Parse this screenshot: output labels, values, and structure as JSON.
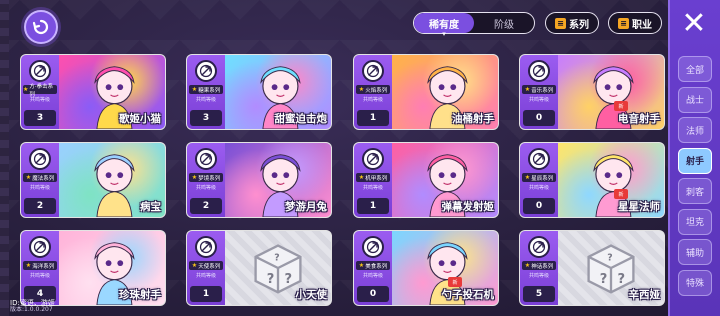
{
  "tabs": [
    {
      "label": "稀有度",
      "active": true
    },
    {
      "label": "阶级",
      "active": false
    }
  ],
  "filters": {
    "series_label": "系列",
    "job_label": "职业"
  },
  "side_tabs": [
    {
      "label": "全部"
    },
    {
      "label": "战士"
    },
    {
      "label": "法师"
    },
    {
      "label": "射手",
      "active": true
    },
    {
      "label": "刺客"
    },
    {
      "label": "坦克"
    },
    {
      "label": "辅助"
    },
    {
      "label": "特殊"
    }
  ],
  "cards": [
    {
      "name": "歌姬小猫",
      "count": "3",
      "tag": "方·拳击系列",
      "sub": "共鸣等级",
      "locked": false,
      "colors": [
        "#ff4fae",
        "#ffd94a",
        "#8b5cf6"
      ]
    },
    {
      "name": "甜蜜迫击炮",
      "count": "3",
      "tag": "糖果系列",
      "sub": "共鸣等级",
      "locked": false,
      "colors": [
        "#6fe0ff",
        "#ff86c8",
        "#b18cff"
      ]
    },
    {
      "name": "油桶射手",
      "count": "1",
      "tag": "火焰系列",
      "sub": "共鸣等级",
      "locked": false,
      "colors": [
        "#ffb347",
        "#ffe08a",
        "#ff7eb3"
      ]
    },
    {
      "name": "电音射手",
      "count": "0",
      "tag": "音乐系列",
      "sub": "共鸣等级",
      "locked": false,
      "colors": [
        "#c77dff",
        "#ff5fa2",
        "#ffd166"
      ],
      "badge": "新"
    },
    {
      "name": "病宝",
      "count": "2",
      "tag": "魔法系列",
      "sub": "共鸣等级",
      "locked": false,
      "colors": [
        "#9ad0ff",
        "#ffe28a",
        "#7fe3c4"
      ]
    },
    {
      "name": "梦游月兔",
      "count": "2",
      "tag": "梦境系列",
      "sub": "共鸣等级",
      "locked": false,
      "colors": [
        "#7a4fd6",
        "#c39bff",
        "#ff8fcf"
      ]
    },
    {
      "name": "弹幕发射姬",
      "count": "1",
      "tag": "机甲系列",
      "sub": "共鸣等级",
      "locked": false,
      "colors": [
        "#ff5fa2",
        "#ff9ad1",
        "#b18cff"
      ]
    },
    {
      "name": "星星法师",
      "count": "0",
      "tag": "星辰系列",
      "sub": "共鸣等级",
      "locked": false,
      "colors": [
        "#ffe56a",
        "#ff9bd2",
        "#8fd8ff"
      ],
      "badge": "新"
    },
    {
      "name": "珍珠射手",
      "count": "4",
      "tag": "海洋系列",
      "sub": "共鸣等级",
      "locked": false,
      "colors": [
        "#ffb3d9",
        "#9ad8ff",
        "#ffe0f0"
      ]
    },
    {
      "name": "小天使",
      "count": "1",
      "tag": "天使系列",
      "sub": "共鸣等级",
      "locked": true,
      "colors": [
        "#e4e4ea",
        "#d8d8e0",
        "#cfcfd8"
      ]
    },
    {
      "name": "勺子投石机",
      "count": "0",
      "tag": "美食系列",
      "sub": "共鸣等级",
      "locked": false,
      "colors": [
        "#7ad6ff",
        "#ffe28a",
        "#ff9ad1"
      ],
      "badge": "新"
    },
    {
      "name": "辛西娅",
      "count": "5",
      "tag": "神话系列",
      "sub": "共鸣等级",
      "locked": true,
      "colors": [
        "#e4e4ea",
        "#d8d8e0",
        "#cfcfd8"
      ]
    }
  ],
  "version": {
    "id_line": "ID:蜜语、游姬",
    "version_line": "版本:1.0.0.207"
  }
}
